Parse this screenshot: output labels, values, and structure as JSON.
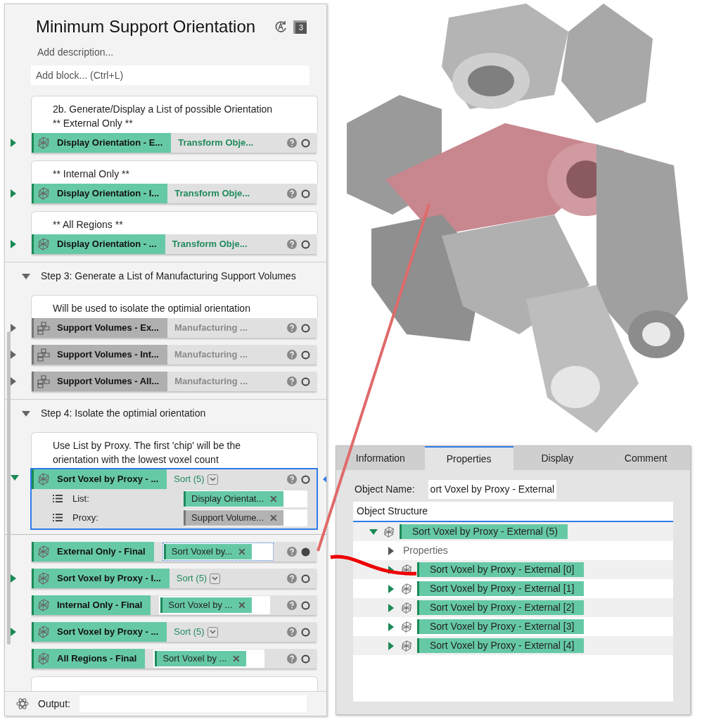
{
  "panel": {
    "title": "Minimum Support Orientation",
    "badge": "3",
    "description_placeholder": "Add description...",
    "add_block_placeholder": "Add block... (Ctrl+L)",
    "items": [
      {
        "kind": "note",
        "lines": [
          "2b. Generate/Display a List of possible Orientation",
          "** External Only **"
        ]
      },
      {
        "kind": "node",
        "name": "Display Orientation - E...",
        "active": true,
        "expandable": true,
        "expanded": false,
        "selected": false,
        "linked": false,
        "value": {
          "kind": "text",
          "text": "Transform Obje..."
        }
      },
      {
        "kind": "note",
        "lines": [
          "** Internal Only **"
        ]
      },
      {
        "kind": "node",
        "name": "Display Orientation  - I...",
        "active": true,
        "expandable": true,
        "expanded": false,
        "selected": false,
        "linked": false,
        "value": {
          "kind": "text",
          "text": "Transform Obje..."
        }
      },
      {
        "kind": "note",
        "lines": [
          "** All Regions **"
        ]
      },
      {
        "kind": "node",
        "name": "Display Orientation  - ...",
        "active": true,
        "expandable": true,
        "expanded": false,
        "selected": false,
        "linked": false,
        "value": {
          "kind": "text",
          "text": "Transform Obje..."
        }
      },
      {
        "kind": "step",
        "text": "Step 3: Generate a List of Manufacturing Support Volumes",
        "expanded": true
      },
      {
        "kind": "note",
        "lines": [
          "Will be used to isolate the optimial orientation"
        ]
      },
      {
        "kind": "node",
        "name": "Support Volumes - Ex...",
        "active": false,
        "expandable": true,
        "expanded": false,
        "selected": false,
        "linked": false,
        "value": {
          "kind": "text",
          "text": "Manufacturing ..."
        }
      },
      {
        "kind": "node",
        "name": "Support Volumes - Int...",
        "active": false,
        "expandable": true,
        "expanded": false,
        "selected": false,
        "linked": false,
        "value": {
          "kind": "text",
          "text": "Manufacturing ..."
        }
      },
      {
        "kind": "node",
        "name": "Support Volumes - All...",
        "active": false,
        "expandable": true,
        "expanded": false,
        "selected": false,
        "linked": false,
        "value": {
          "kind": "text",
          "text": "Manufacturing ..."
        }
      },
      {
        "kind": "step",
        "text": "Step 4: Isolate the optimial orientation",
        "expanded": true
      },
      {
        "kind": "note",
        "lines": [
          "Use List by Proxy. The first 'chip' will be the",
          "orientation with the lowest voxel count"
        ]
      },
      {
        "kind": "node",
        "name": "Sort Voxel by Proxy - ...",
        "active": true,
        "expandable": true,
        "expanded": true,
        "selected": true,
        "linked": false,
        "value": {
          "kind": "dropdown",
          "text": "Sort (5)"
        },
        "params": [
          {
            "label": "List:",
            "chip": {
              "text": "Display Orientat...",
              "active": true,
              "remove": "✕"
            }
          },
          {
            "label": "Proxy:",
            "chip": {
              "text": "Support Volume...",
              "active": false,
              "remove": "✕"
            }
          }
        ]
      },
      {
        "kind": "divider"
      },
      {
        "kind": "node",
        "name": "External Only - Final",
        "active": true,
        "expandable": false,
        "expanded": false,
        "selected": false,
        "linked": true,
        "value": {
          "kind": "reference",
          "text": "Sort Voxel by...",
          "focused": true,
          "remove": "✕"
        }
      },
      {
        "kind": "node",
        "name": "Sort Voxel by Proxy - I...",
        "active": true,
        "expandable": true,
        "expanded": false,
        "selected": false,
        "linked": false,
        "value": {
          "kind": "dropdown",
          "text": "Sort (5)"
        }
      },
      {
        "kind": "node",
        "name": "Internal Only - Final",
        "active": true,
        "expandable": false,
        "expanded": false,
        "selected": false,
        "linked": false,
        "value": {
          "kind": "reference",
          "text": "Sort Voxel by ...",
          "focused": false,
          "remove": "✕"
        }
      },
      {
        "kind": "node",
        "name": "Sort Voxel by Proxy - ...",
        "active": true,
        "expandable": true,
        "expanded": false,
        "selected": false,
        "linked": false,
        "value": {
          "kind": "dropdown",
          "text": "Sort (5)"
        }
      },
      {
        "kind": "node",
        "name": "All Regions - Final",
        "active": true,
        "expandable": false,
        "expanded": false,
        "selected": false,
        "linked": false,
        "value": {
          "kind": "reference",
          "text": "Sort Voxel by ...",
          "focused": false,
          "remove": "✕"
        }
      }
    ],
    "output": {
      "label": "Output:"
    }
  },
  "properties_panel": {
    "tabs": [
      {
        "label": "Information",
        "selected": false
      },
      {
        "label": "Properties",
        "selected": true
      },
      {
        "label": "Display",
        "selected": false
      },
      {
        "label": "Comment",
        "selected": false
      }
    ],
    "object_name": {
      "label": "Object Name:",
      "value": "ort Voxel by Proxy - External"
    },
    "structure": {
      "header": "Object Structure",
      "tree": [
        {
          "kind": "object",
          "label": "Sort Voxel by Proxy - External (5)",
          "expanded": true,
          "children": [
            {
              "kind": "group",
              "label": "Properties",
              "expanded": false
            },
            {
              "kind": "object",
              "label": "Sort Voxel by Proxy - External [0]",
              "expanded": false
            },
            {
              "kind": "object",
              "label": "Sort Voxel by Proxy - External [1]",
              "expanded": false
            },
            {
              "kind": "object",
              "label": "Sort Voxel by Proxy - External [2]",
              "expanded": false
            },
            {
              "kind": "object",
              "label": "Sort Voxel by Proxy - External [3]",
              "expanded": false
            },
            {
              "kind": "object",
              "label": "Sort Voxel by Proxy - External [4]",
              "expanded": false
            }
          ]
        }
      ]
    }
  }
}
